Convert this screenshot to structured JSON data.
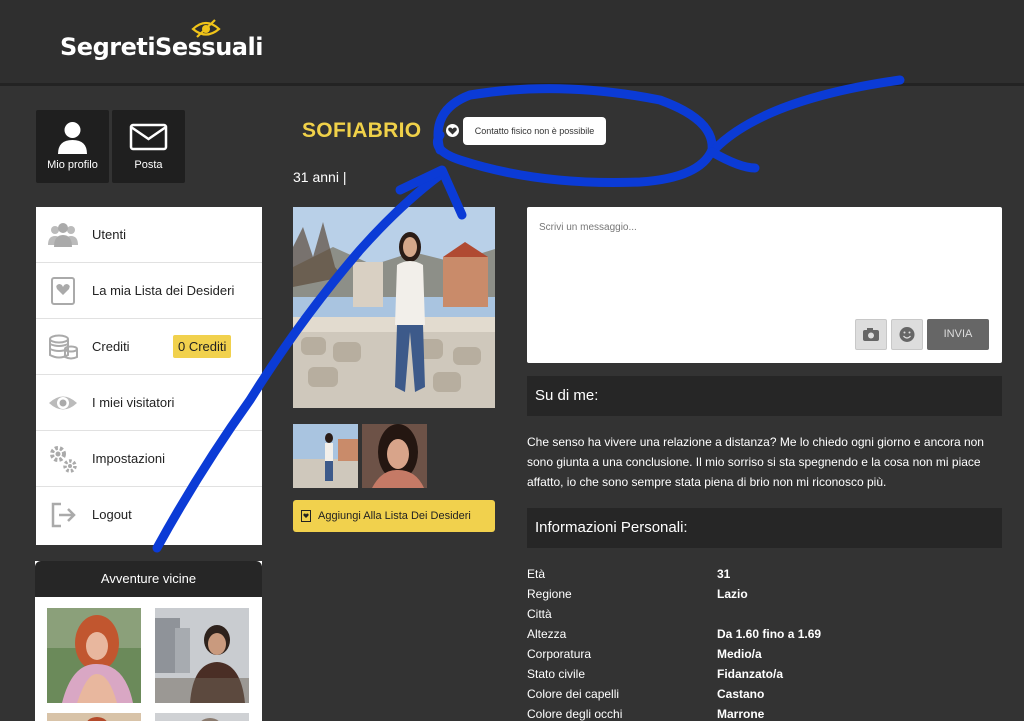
{
  "brand": {
    "logo": "SegretiSessuali"
  },
  "tiles": [
    {
      "label": "Mio profilo",
      "icon": "user-icon"
    },
    {
      "label": "Posta",
      "icon": "envelope-icon"
    }
  ],
  "menu": {
    "items": [
      {
        "label": "Utenti",
        "icon": "users-icon"
      },
      {
        "label": "La mia Lista dei Desideri",
        "icon": "wishlist-icon"
      },
      {
        "label": "Crediti",
        "icon": "coins-icon"
      },
      {
        "label": "I miei visitatori",
        "icon": "eye-icon"
      },
      {
        "label": "Impostazioni",
        "icon": "gears-icon"
      },
      {
        "label": "Logout",
        "icon": "logout-icon"
      }
    ],
    "credits_badge": "0 Crediti"
  },
  "nearby": {
    "title": "Avventure vicine"
  },
  "profile": {
    "username": "SOFIABRIO",
    "tooltip": "Contatto fisico non è possibile",
    "age": "31 anni |",
    "wishlist_button": "Aggiungi Alla Lista Dei Desideri"
  },
  "message": {
    "placeholder": "Scrivi un messaggio...",
    "send_label": "INVIA"
  },
  "about": {
    "title": "Su di me:",
    "text": "Che senso ha vivere una relazione a distanza? Me lo chiedo ogni giorno e ancora non sono giunta a una conclusione. Il mio sorriso si sta spegnendo e la cosa non mi piace affatto, io che sono sempre stata piena di brio non mi riconosco più."
  },
  "personal": {
    "title": "Informazioni Personali:",
    "rows": [
      {
        "key": "Età",
        "value": "31"
      },
      {
        "key": "Regione",
        "value": "Lazio"
      },
      {
        "key": "Città",
        "value": ""
      },
      {
        "key": "Altezza",
        "value": "Da 1.60 fino a 1.69"
      },
      {
        "key": "Corporatura",
        "value": "Medio/a"
      },
      {
        "key": "Stato civile",
        "value": "Fidanzato/a"
      },
      {
        "key": "Colore dei capelli",
        "value": "Castano"
      },
      {
        "key": "Colore degli occhi",
        "value": "Marrone"
      }
    ]
  },
  "colors": {
    "accent": "#f1d14d",
    "background": "#333333",
    "panel_dark": "#262626",
    "annotation": "#0b3bd6"
  }
}
